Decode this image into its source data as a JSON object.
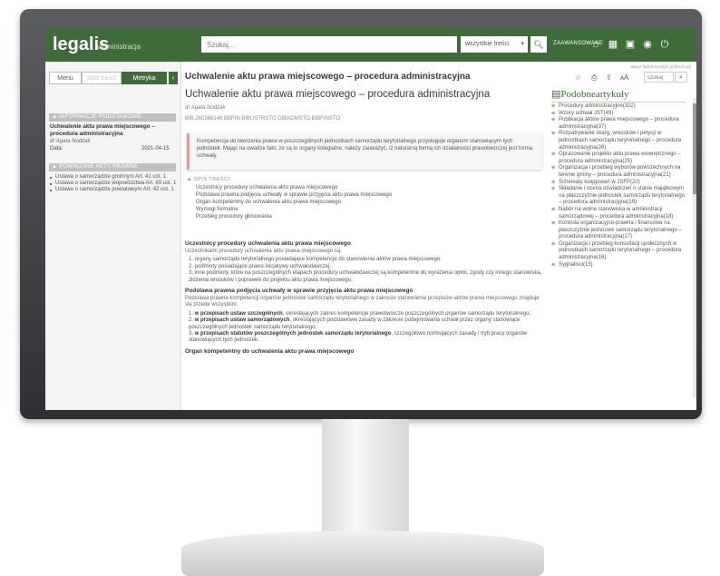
{
  "header": {
    "logo": "legalis",
    "logo_sub": "administracja",
    "search_placeholder": "Szukaj...",
    "scope_select": "wszystkie treści",
    "advanced_label": "ZAAWANSOWANE"
  },
  "left_panel": {
    "tabs": [
      "Menu",
      "Spis treści",
      "Metryka"
    ],
    "info_head": "▲ INFORMACJE PODSTAWOWE",
    "doc_title": "Uchwalenie aktu prawa miejscowego – procedura administracyjna",
    "doc_author": "dr Agata Nodżak",
    "date_label": "Data:",
    "date_value": "2021-04-15",
    "related_head": "▲ POWIĄZANE AKTY PRAWNE",
    "related": [
      "Ustawa o samorządzie gminnym Art. 41 ust. 1",
      "Ustawa o samorządzie województwa Art. 89 ust. 1",
      "Ustawa o samorządzie powiatowym Art. 42 ust. 1"
    ]
  },
  "main": {
    "page_title": "Uchwalenie aktu prawa miejscowego – procedura administracyjna",
    "doc_heading": "Uchwalenie aktu prawa miejscowego – procedura administracyjna",
    "author": "dr Agata Nodżak",
    "ids": "BIB.260366148 BBFIN BIBUSTRSTO DIBADMSTO.BIBFINSTO",
    "quote": "Kompetencja do tworzenia prawa w poszczególnych jednostkach samorządu terytorialnego przysługuje organom stanowiącym tych jednostek. Mając na uwadze fakt, że są to organy kolegialne, należy zauważyć, iż naturalną formą ich działalności prawotwórczej jest forma uchwały.",
    "toc_head": "▲ SPIS TREŚCI",
    "toc": [
      "Uczestnicy procedury uchwalenia aktu prawa miejscowego",
      "Podstawa prawna podjęcia uchwały w sprawie przyjęcia aktu prawa miejscowego",
      "Organ kompetentny do uchwalenia aktu prawa miejscowego",
      "Wymogi formalne",
      "Przebieg procedury głosowania"
    ],
    "s1_head": "Uczestnicy procedury uchwalenia aktu prawa miejscowego",
    "s1_intro": "Uczestnikami procedury uchwalenia aktu prawa miejscowego są:",
    "s1_items": [
      "1. organy samorządu terytorialnego posiadające kompetencje do stanowienia aktów prawa miejscowego;",
      "2. podmioty posiadające prawo inicjatywy uchwałodawczej;",
      "3. inne podmioty, które na poszczególnych etapach procedury uchwałodawczej są kompetentne do wyrażenia opinii, zgody czy innego stanowiska, złożenia wniosków i poprawek do projektu aktu prawa miejscowego."
    ],
    "s2_head": "Podstawa prawna podjęcia uchwały w sprawie przyjęcia aktu prawa miejscowego",
    "s2_intro": "Podstawa prawna kompetencji organów jednostek samorządu terytorialnego w zakresie stanowienia przepisów aktów prawa miejscowego znajduje się przede wszystkim:",
    "s2_items": [
      {
        "n": "1. ",
        "b": "w przepisach ustaw szczególnych",
        "t": ", określających zakres kompetencje prawotwórcze poszczególnych organów samorządu terytorialnego;"
      },
      {
        "n": "2. ",
        "b": "w przepisach ustaw samorządowych",
        "t": ", określających podstawowe zasady w zakresie podejmowania uchwał przez organy stanowiące poszczególnych jednostek samorządu terytorialnego;"
      },
      {
        "n": "3. ",
        "b": "w przepisach statutów poszczególnych jednostek samorządu terytorialnego",
        "t": ", szczegółowo normujących zasady i tryb pracy organów stanowiących tych jednostek."
      }
    ],
    "s3_head": "Organ kompetentny do uchwalenia aktu prawa miejscowego"
  },
  "right_panel": {
    "tiny_link": "Włącz tła/kolory/style (pdf/tech.pl)",
    "search_placeholder": "szukaj",
    "similar_title": "Podobneartykuły",
    "similar": [
      "Procedury administracyjne(322)",
      "Wzory uchwał JST(49)",
      "Publikacja aktów prawa miejscowego – procedura administracyjna(37)",
      "Rozpatrywanie skarg, wniosków i petycji w jednostkach samorządu terytorialnego – procedura administracyjna(26)",
      "Opracowanie projektu aktu prawa wewnętrznego – procedura administracyjna(25)",
      "Organizacja i przebieg wyborów powszechnych na terenie gminy – procedura administracyjna(21)",
      "Schematy księgowań w JSFP(20)",
      "Składanie i ocena oświadczeń o stanie majątkowym na płaszczyźnie jednostek samorządu terytorialnego – procedura administracyjna(19)",
      "Nabór na wolne stanowiska w administracji samorządowej – procedura administracyjna(18)",
      "Kontrola organizacyjno-prawna i finansowa na płaszczyźnie jednostek samorządu terytorialnego – procedura administracyjna(17)",
      "Organizacja i przebieg konsultacji społecznych w jednostkach samorządu terytorialnego – procedura administracyjna(16)",
      "Sygnaliści(15)"
    ]
  },
  "colors": {
    "brand": "#3f6b3a",
    "quote_border": "#d9a0a0"
  },
  "icons": [
    "home-icon",
    "calendar-icon",
    "briefcase-icon",
    "user-icon",
    "power-icon",
    "star-icon",
    "print-icon",
    "export-icon",
    "font-size-icon",
    "search-icon"
  ]
}
